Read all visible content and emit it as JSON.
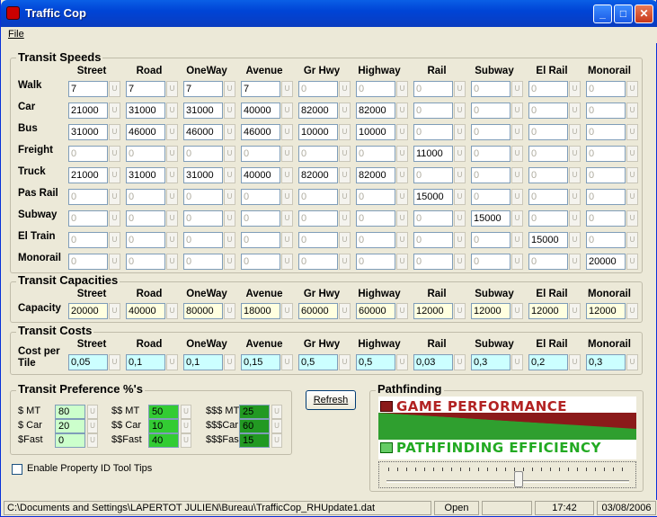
{
  "window": {
    "title": "Traffic Cop"
  },
  "menu": {
    "file": "File"
  },
  "speeds": {
    "title": "Transit Speeds",
    "columns": [
      "Street",
      "Road",
      "OneWay",
      "Avenue",
      "Gr Hwy",
      "Highway",
      "Rail",
      "Subway",
      "El Rail",
      "Monorail"
    ],
    "rows": [
      {
        "label": "Walk",
        "values": [
          "7",
          "7",
          "7",
          "7",
          "0",
          "0",
          "0",
          "0",
          "0",
          "0"
        ],
        "enabled": [
          1,
          1,
          1,
          1,
          0,
          0,
          0,
          0,
          0,
          0
        ]
      },
      {
        "label": "Car",
        "values": [
          "21000",
          "31000",
          "31000",
          "40000",
          "82000",
          "82000",
          "0",
          "0",
          "0",
          "0"
        ],
        "enabled": [
          1,
          1,
          1,
          1,
          1,
          1,
          0,
          0,
          0,
          0
        ]
      },
      {
        "label": "Bus",
        "values": [
          "31000",
          "46000",
          "46000",
          "46000",
          "10000",
          "10000",
          "0",
          "0",
          "0",
          "0"
        ],
        "enabled": [
          1,
          1,
          1,
          1,
          1,
          1,
          0,
          0,
          0,
          0
        ]
      },
      {
        "label": "Freight",
        "values": [
          "0",
          "0",
          "0",
          "0",
          "0",
          "0",
          "11000",
          "0",
          "0",
          "0"
        ],
        "enabled": [
          0,
          0,
          0,
          0,
          0,
          0,
          1,
          0,
          0,
          0
        ]
      },
      {
        "label": "Truck",
        "values": [
          "21000",
          "31000",
          "31000",
          "40000",
          "82000",
          "82000",
          "0",
          "0",
          "0",
          "0"
        ],
        "enabled": [
          1,
          1,
          1,
          1,
          1,
          1,
          0,
          0,
          0,
          0
        ]
      },
      {
        "label": "Pas Rail",
        "values": [
          "0",
          "0",
          "0",
          "0",
          "0",
          "0",
          "15000",
          "0",
          "0",
          "0"
        ],
        "enabled": [
          0,
          0,
          0,
          0,
          0,
          0,
          1,
          0,
          0,
          0
        ]
      },
      {
        "label": "Subway",
        "values": [
          "0",
          "0",
          "0",
          "0",
          "0",
          "0",
          "0",
          "15000",
          "0",
          "0"
        ],
        "enabled": [
          0,
          0,
          0,
          0,
          0,
          0,
          0,
          1,
          0,
          0
        ]
      },
      {
        "label": "El Train",
        "values": [
          "0",
          "0",
          "0",
          "0",
          "0",
          "0",
          "0",
          "0",
          "15000",
          "0"
        ],
        "enabled": [
          0,
          0,
          0,
          0,
          0,
          0,
          0,
          0,
          1,
          0
        ]
      },
      {
        "label": "Monorail",
        "values": [
          "0",
          "0",
          "0",
          "0",
          "0",
          "0",
          "0",
          "0",
          "0",
          "20000"
        ],
        "enabled": [
          0,
          0,
          0,
          0,
          0,
          0,
          0,
          0,
          0,
          1
        ]
      }
    ]
  },
  "capacities": {
    "title": "Transit Capacities",
    "row_label": "Capacity",
    "values": [
      "20000",
      "40000",
      "80000",
      "18000",
      "60000",
      "60000",
      "12000",
      "12000",
      "12000",
      "12000"
    ]
  },
  "costs": {
    "title": "Transit Costs",
    "row_label_1": "Cost per",
    "row_label_2": "Tile",
    "values": [
      "0,05",
      "0,1",
      "0,1",
      "0,15",
      "0,5",
      "0,5",
      "0,03",
      "0,3",
      "0,2",
      "0,3"
    ]
  },
  "preference": {
    "title": "Transit Preference %'s",
    "items": [
      {
        "label": "$ MT",
        "value": "80"
      },
      {
        "label": "$ Car",
        "value": "20"
      },
      {
        "label": "$Fast",
        "value": "0"
      },
      {
        "label": "$$ MT",
        "value": "50"
      },
      {
        "label": "$$ Car",
        "value": "10"
      },
      {
        "label": "$$Fast",
        "value": "40"
      },
      {
        "label": "$$$ MT",
        "value": "25"
      },
      {
        "label": "$$$Car",
        "value": "60"
      },
      {
        "label": "$$$Fast",
        "value": "15"
      }
    ]
  },
  "refresh_label": "Refresh",
  "tooltips_label": "Enable Property ID Tool Tips",
  "pathfinding": {
    "title": "Pathfinding",
    "top_label": "GAME PERFORMANCE",
    "bottom_label": "PATHFINDING EFFICIENCY"
  },
  "status": {
    "path": "C:\\Documents and Settings\\LAPERTOT JULIEN\\Bureau\\TrafficCop_RHUpdate1.dat",
    "state": "Open",
    "time": "17:42",
    "date": "03/08/2006"
  },
  "icons": {
    "app": "traffic-cop-icon",
    "minimize": "minimize-icon",
    "maximize": "maximize-icon",
    "close": "close-icon"
  },
  "colors": {
    "title_blue": "#0a5fe6",
    "capacity_bg": "#ffffe0",
    "cost_bg": "#ccffff",
    "green_pref": "#33cc33",
    "dark_red": "#8b1a1a",
    "green_bar": "#33aa33"
  }
}
